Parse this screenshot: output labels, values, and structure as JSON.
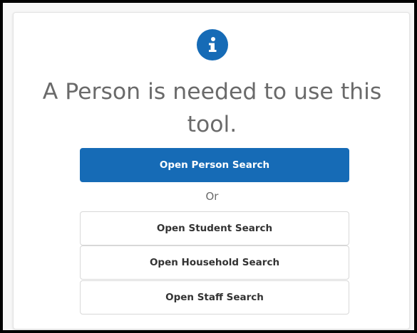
{
  "dialog": {
    "icon": "info-icon",
    "message": "A Person is needed to use this tool.",
    "primary_button_label": "Open Person Search",
    "separator_text": "Or",
    "secondary_buttons": [
      {
        "label": "Open Student Search"
      },
      {
        "label": "Open Household Search"
      },
      {
        "label": "Open Staff Search"
      }
    ]
  },
  "colors": {
    "accent": "#166bb6",
    "message_text": "#6a6a6a",
    "secondary_button_text": "#333333",
    "border": "#d8d8d8"
  }
}
